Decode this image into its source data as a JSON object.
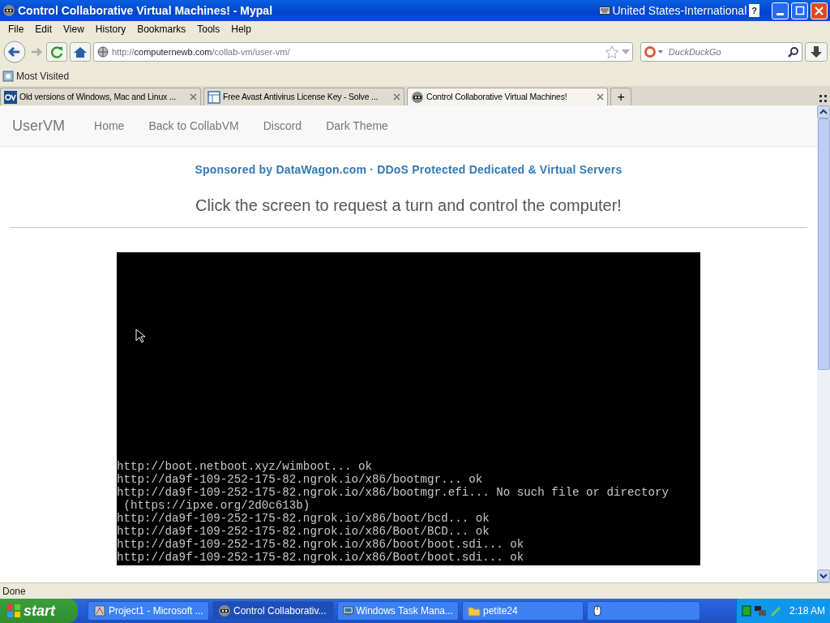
{
  "window": {
    "title": "Control Collaborative Virtual Machines! - Mypal",
    "keyboard_layout": "United States-International",
    "help_key": "?"
  },
  "menu": [
    "File",
    "Edit",
    "View",
    "History",
    "Bookmarks",
    "Tools",
    "Help"
  ],
  "address": {
    "scheme": "http://",
    "host": "computernewb.com",
    "path": "/collab-vm/user-vm/"
  },
  "search": {
    "placeholder": "DuckDuckGo"
  },
  "bookmarks": [
    "Most Visited"
  ],
  "tabs": [
    {
      "label": "Old versions of Windows, Mac and Linux ...",
      "selected": false
    },
    {
      "label": "Free Avast Antivirus License Key - Solve ...",
      "selected": false
    },
    {
      "label": "Control Collaborative Virtual Machines!",
      "selected": true
    }
  ],
  "new_tab": "+",
  "page": {
    "brand": "UserVM",
    "nav": [
      "Home",
      "Back to CollabVM",
      "Discord",
      "Dark Theme"
    ],
    "sponsor": "Sponsored by DataWagon.com · DDoS Protected Dedicated & Virtual Servers",
    "heading": "Click the screen to request a turn and control the computer!",
    "vm_console": [
      "http://boot.netboot.xyz/wimboot... ok",
      "http://da9f-109-252-175-82.ngrok.io/x86/bootmgr... ok",
      "http://da9f-109-252-175-82.ngrok.io/x86/bootmgr.efi... No such file or directory",
      " (https://ipxe.org/2d0c613b)",
      "http://da9f-109-252-175-82.ngrok.io/x86/boot/bcd... ok",
      "http://da9f-109-252-175-82.ngrok.io/x86/Boot/BCD... ok",
      "http://da9f-109-252-175-82.ngrok.io/x86/boot/boot.sdi... ok",
      "http://da9f-109-252-175-82.ngrok.io/x86/Boot/boot.sdi... ok"
    ]
  },
  "status_bar": "Done",
  "taskbar": {
    "start": "start",
    "tasks": [
      {
        "label": "Project1 - Microsoft ...",
        "selected": false
      },
      {
        "label": "Control Collaborativ...",
        "selected": true
      },
      {
        "label": "Windows Task Mana...",
        "selected": false
      },
      {
        "label": "petite24",
        "selected": false
      }
    ],
    "clock": "2:18 AM"
  }
}
